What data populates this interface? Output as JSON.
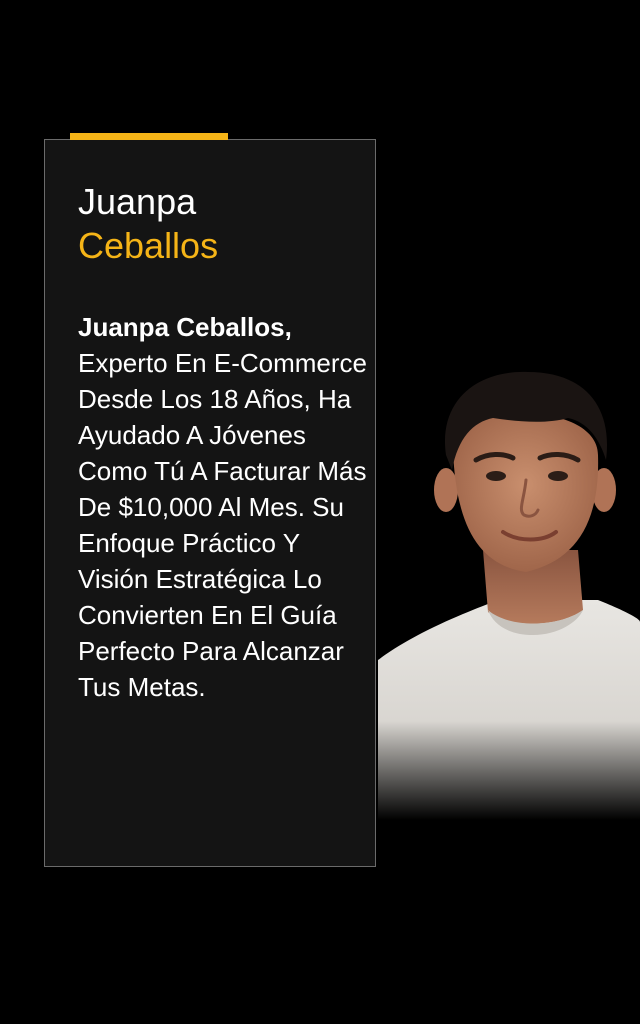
{
  "profile": {
    "first_name": "Juanpa",
    "last_name": "Ceballos"
  },
  "bio": {
    "name": "Juanpa Ceballos,",
    "text": "Experto En E-Commerce Desde Los 18 Años, Ha Ayudado A Jóvenes Como Tú A Facturar Más De $10,000 Al Mes. Su Enfoque Práctico Y Visión Estratégica Lo Convierten En El Guía Perfecto Para Alcanzar Tus Metas."
  },
  "colors": {
    "background": "#000000",
    "card": "#141414",
    "card_border": "#6b6b6b",
    "accent": "#f5b417",
    "text": "#ffffff"
  }
}
